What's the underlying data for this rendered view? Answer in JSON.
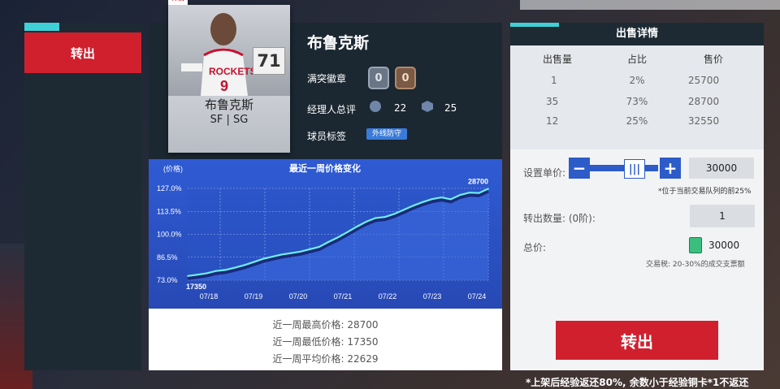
{
  "sidebar": {
    "tab_label": "转出"
  },
  "card": {
    "detail_label": "详情",
    "team_text": "ROCKETS",
    "jersey_number": "9",
    "overall": "71",
    "name": "布鲁克斯",
    "positions": "SF | SG"
  },
  "player": {
    "name": "布鲁克斯",
    "badges_label": "满突徽章",
    "badge_counts": [
      "0",
      "0"
    ],
    "manager_label": "经理人总评",
    "manager_score_a": "22",
    "manager_score_b": "25",
    "tags_label": "球员标签",
    "tag": "外线防守"
  },
  "chart_data": {
    "type": "line",
    "title": "最近一周价格变化",
    "ylabel": "(价格)",
    "y_ticks": [
      "127.0%",
      "113.5%",
      "100.0%",
      "86.5%",
      "73.0%"
    ],
    "x_ticks": [
      "07/18",
      "07/19",
      "07/20",
      "07/21",
      "07/22",
      "07/23",
      "07/24"
    ],
    "ylim": [
      73.0,
      127.0
    ],
    "start_label": "17350",
    "end_label": "28700",
    "series": [
      {
        "values": [
          75.5,
          76.2,
          77.0,
          78.4,
          79.0,
          80.3,
          81.8,
          83.6,
          85.5,
          86.8,
          88.1,
          88.9,
          89.8,
          91.2,
          92.6,
          95.5,
          98.2,
          101.3,
          104.5,
          107.4,
          109.6,
          110.2,
          112.0,
          114.4,
          116.8,
          118.9,
          120.7,
          121.7,
          120.6,
          123.2,
          124.5,
          124.3,
          126.8
        ]
      }
    ],
    "grid": true
  },
  "stats": {
    "high": "近一周最高价格:  28700",
    "low": "近一周最低价格:  17350",
    "avg": "近一周平均价格:  22629"
  },
  "sale": {
    "title": "出售详情",
    "headers": [
      "出售量",
      "占比",
      "售价"
    ],
    "rows": [
      [
        "1",
        "2%",
        "25700"
      ],
      [
        "35",
        "73%",
        "28700"
      ],
      [
        "12",
        "25%",
        "32550"
      ]
    ],
    "unit_price_label": "设置单价:",
    "unit_price": "30000",
    "queue_note": "*位于当前交易队列的前25%",
    "qty_label": "转出数量:  (0阶):",
    "qty": "1",
    "total_label": "总价:",
    "total": "30000",
    "tax_note": "交易税: 20-30%的成交支票额",
    "sell_button": "转出",
    "footnote": "*上架后经验返还80%, 余数小于经验铜卡*1不返还"
  },
  "colors": {
    "accent_red": "#d0202e",
    "accent_blue": "#2d5cc9",
    "line_cyan": "#6ff0f0"
  }
}
